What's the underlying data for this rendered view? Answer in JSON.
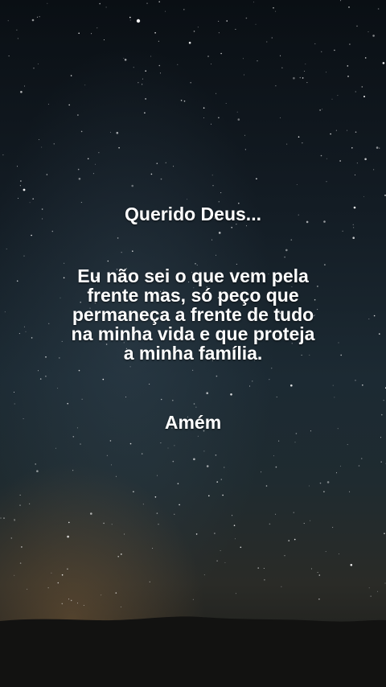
{
  "prayer": {
    "greeting": "Querido Deus...",
    "body": "Eu não sei o que vem pela frente mas, só peço que permaneça a frente de tudo na minha vida e que proteja a minha família.",
    "closing": "Amém"
  },
  "background": {
    "description_icon": "starry-night-sky",
    "sky_top_color": "#0a0f14",
    "sky_horizon_color": "#2a2b27",
    "glow_color": "#785a37",
    "ground_color": "#111110"
  }
}
